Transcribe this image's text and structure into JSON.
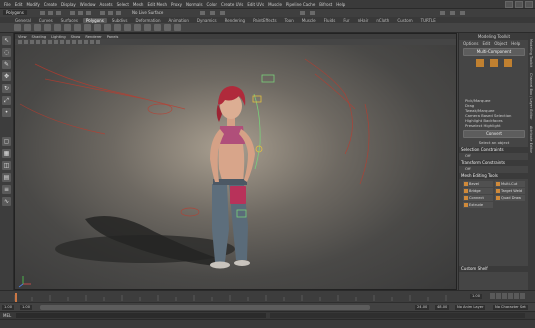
{
  "menubar": {
    "items": [
      "File",
      "Edit",
      "Modify",
      "Create",
      "Display",
      "Window",
      "Assets",
      "Select",
      "Mesh",
      "Edit Mesh",
      "Proxy",
      "Normals",
      "Color",
      "Create UVs",
      "Edit UVs",
      "Muscle",
      "Pipeline Cache",
      "Bifrost",
      "Help"
    ]
  },
  "shelf": {
    "tabs": [
      "General",
      "Curves",
      "Surfaces",
      "Polygons",
      "Subdivs",
      "Deformation",
      "Animation",
      "Dynamics",
      "Rendering",
      "PaintEffects",
      "Toon",
      "Muscle",
      "Fluids",
      "Fur",
      "nHair",
      "nCloth",
      "Custom",
      "TURTLE"
    ],
    "active_tab": "Polygons"
  },
  "viewport": {
    "menu": [
      "View",
      "Shading",
      "Lighting",
      "Show",
      "Renderer",
      "Panels"
    ]
  },
  "attribute_panel": {
    "title": "Modeling Toolkit",
    "menu": [
      "Options",
      "Edit",
      "Object",
      "Help"
    ],
    "multi_component": "Multi-Component",
    "options": [
      "Pick/Marquee",
      "Drag",
      "Tweak/Marquee",
      "Camera Based Selection",
      "Highlight Backfaces",
      "Preselect Highlight"
    ],
    "convert": "Convert",
    "select_all": "Select an object",
    "symmetry_header": "Selection Constraints",
    "symmetry_value": "Off",
    "transform_header": "Transform Constraints",
    "transform_value": "Off",
    "mesh_tools_header": "Mesh Editing Tools",
    "tools": [
      "Bevel",
      "Multi-Cut",
      "Bridge",
      "Target Weld",
      "Connect",
      "Quad Draw",
      "Extrude",
      ""
    ],
    "custom_shelf": "Custom Shelf"
  },
  "side_tabs": [
    "Modeling Toolkit",
    "Channel Box / Layer Editor",
    "Attribute Editor"
  ],
  "timeline": {
    "start": "1.00",
    "end": "24.00",
    "range_start": "1.00",
    "range_end": "48.00",
    "current": "1.00",
    "anim_layer": "No Anim Layer",
    "char_set": "No Character Set"
  },
  "status_line": {
    "mode": "Polygons",
    "live": "No Live Surface"
  },
  "cmdline": {
    "label": "MEL"
  }
}
